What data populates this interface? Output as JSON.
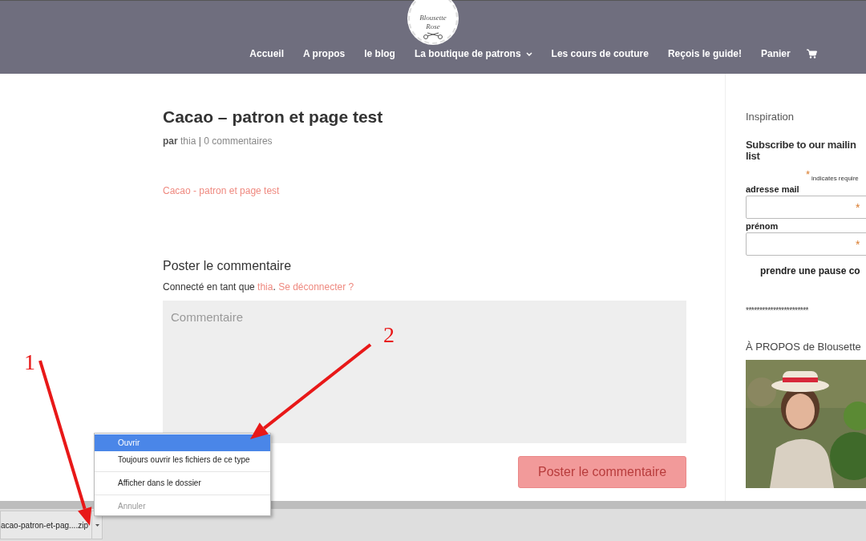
{
  "header": {
    "logo": {
      "line1": "Blousette",
      "line2": "Rose"
    },
    "nav": [
      {
        "label": "Accueil",
        "dropdown": false
      },
      {
        "label": "A propos",
        "dropdown": false
      },
      {
        "label": "le blog",
        "dropdown": false
      },
      {
        "label": "La boutique de patrons",
        "dropdown": true
      },
      {
        "label": "Les cours de couture",
        "dropdown": false
      },
      {
        "label": "Reçois le guide!",
        "dropdown": false
      },
      {
        "label": "Panier",
        "dropdown": false
      }
    ]
  },
  "post": {
    "title": "Cacao – patron et page test",
    "meta": {
      "prefix": "par",
      "author": "thia",
      "separator": "|",
      "comments": "0 commentaires"
    },
    "attachment_link": "Cacao - patron et page test"
  },
  "comment_form": {
    "heading": "Poster le commentaire",
    "logged_in": {
      "prefix": "Connecté en tant que",
      "user": "thia",
      "suffix": ".",
      "logout": "Se déconnecter ?"
    },
    "textarea": {
      "placeholder": "Commentaire"
    },
    "submit": "Poster le commentaire"
  },
  "sidebar": {
    "widget_title": "Inspiration",
    "subscribe": {
      "title": "Subscribe to our mailin list",
      "required_note": {
        "mark": "*",
        "text": "indicates require"
      },
      "fields": [
        {
          "label": "adresse mail",
          "mark": "*"
        },
        {
          "label": "prénom",
          "mark": "*"
        }
      ],
      "option": "prendre une pause co"
    },
    "stars_line": "***********************",
    "about_title": "À PROPOS de Blousette"
  },
  "download_bar": {
    "file": "acao-patron-et-pag....zip"
  },
  "context_menu": [
    {
      "label": "Ouvrir",
      "selected": true,
      "disabled": false,
      "divider_before": false
    },
    {
      "label": "Toujours ouvrir les fichiers de ce type",
      "selected": false,
      "disabled": false,
      "divider_before": false
    },
    {
      "label": "Afficher dans le dossier",
      "selected": false,
      "disabled": false,
      "divider_before": true
    },
    {
      "label": "Annuler",
      "selected": false,
      "disabled": true,
      "divider_before": true
    }
  ],
  "annotations": [
    {
      "label": "1"
    },
    {
      "label": "2"
    }
  ]
}
